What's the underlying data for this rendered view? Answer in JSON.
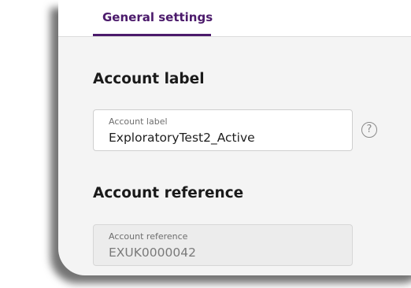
{
  "tabs": {
    "active_label": "General settings"
  },
  "account_label_section": {
    "title": "Account label",
    "field_label": "Account label",
    "value": "ExploratoryTest2_Active",
    "help_icon": "question-circle-icon"
  },
  "account_reference_section": {
    "title": "Account reference",
    "field_label": "Account reference",
    "value": "EXUK0000042"
  },
  "colors": {
    "accent": "#4b1a6b",
    "panel_background": "#f4f4f4",
    "readonly_field": "#ececec"
  }
}
